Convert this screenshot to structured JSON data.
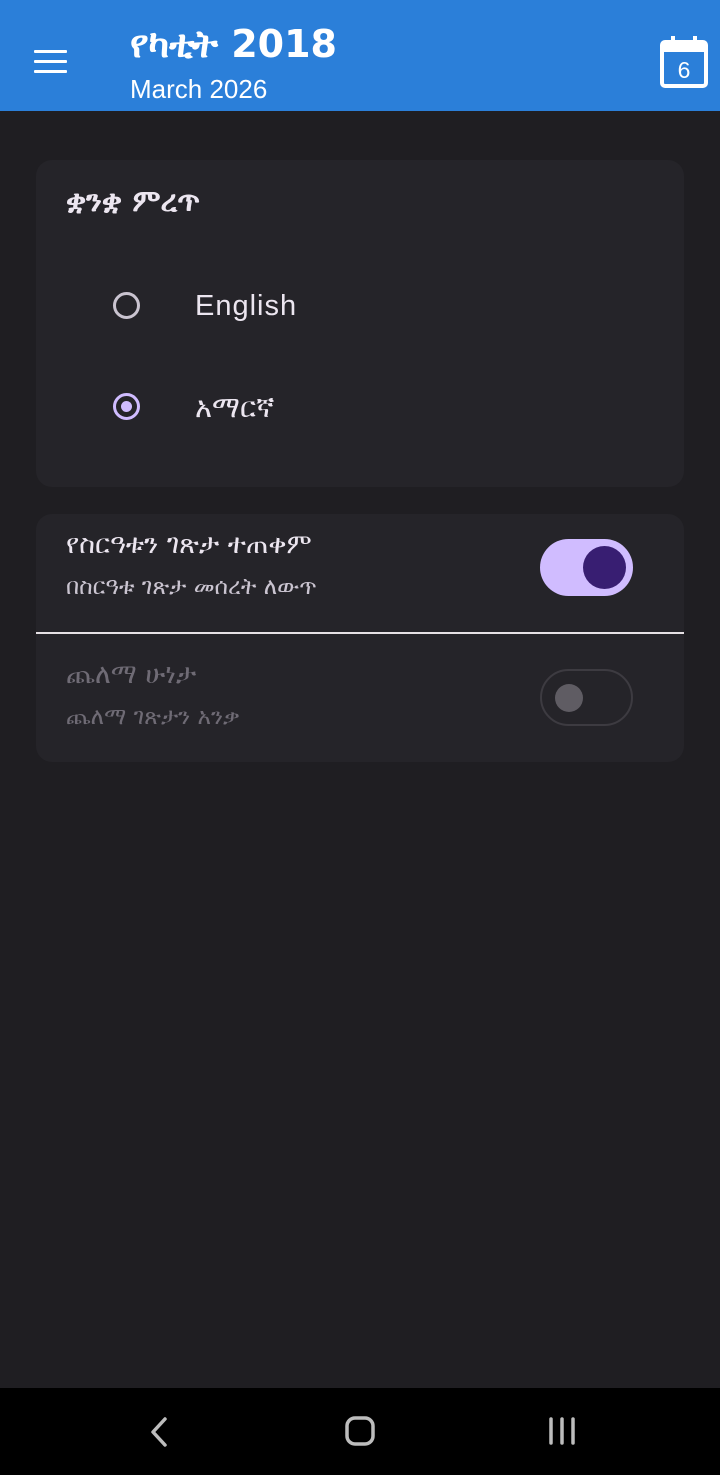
{
  "app_bar": {
    "title": "የካቲት 2018",
    "subtitle": "March 2026",
    "calendar_day": "6",
    "background": "#2b7fd9"
  },
  "language_card": {
    "title": "ቋንቋ ምረጥ",
    "options": [
      {
        "label": "English",
        "selected": false
      },
      {
        "label": "አማርኛ",
        "selected": true
      }
    ]
  },
  "settings_card": {
    "system_theme": {
      "title": "የስርዓቱን ገጽታ ተጠቀም",
      "subtitle": "በስርዓቱ ገጽታ መሰረት ለውጥ",
      "enabled": true
    },
    "dark_mode": {
      "title": "ጨለማ ሁነታ",
      "subtitle": "ጨለማ ገጽታን አንቃ",
      "enabled": false,
      "disabled": true
    }
  },
  "icons": {
    "menu": "menu-icon",
    "calendar": "calendar-icon",
    "back": "back-icon",
    "home": "home-icon",
    "recents": "recents-icon"
  },
  "colors": {
    "background": "#1f1e22",
    "card": "#252429",
    "accent": "#d0bcff",
    "accent_dark": "#381e72"
  }
}
